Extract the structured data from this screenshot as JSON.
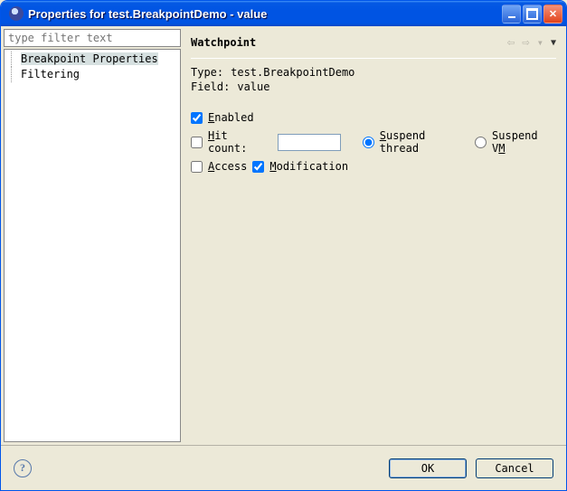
{
  "window": {
    "title": "Properties for test.BreakpointDemo - value"
  },
  "sidebar": {
    "filter_placeholder": "type filter text",
    "items": [
      {
        "label": "Breakpoint Properties",
        "selected": true
      },
      {
        "label": "Filtering",
        "selected": false
      }
    ]
  },
  "main": {
    "heading": "Watchpoint",
    "type_label": "Type:",
    "type_value": "test.BreakpointDemo",
    "field_label": "Field:",
    "field_value": "value"
  },
  "form": {
    "enabled_label": "Enabled",
    "enabled": true,
    "hitcount_label": "Hit count:",
    "hitcount_enabled": false,
    "hitcount_value": "",
    "suspend_thread_label": "Suspend thread",
    "suspend_vm_label": "Suspend VM",
    "suspend_mode": "thread",
    "access_label": "Access",
    "access": false,
    "modification_label": "Modification",
    "modification": true
  },
  "buttons": {
    "ok": "OK",
    "cancel": "Cancel"
  }
}
